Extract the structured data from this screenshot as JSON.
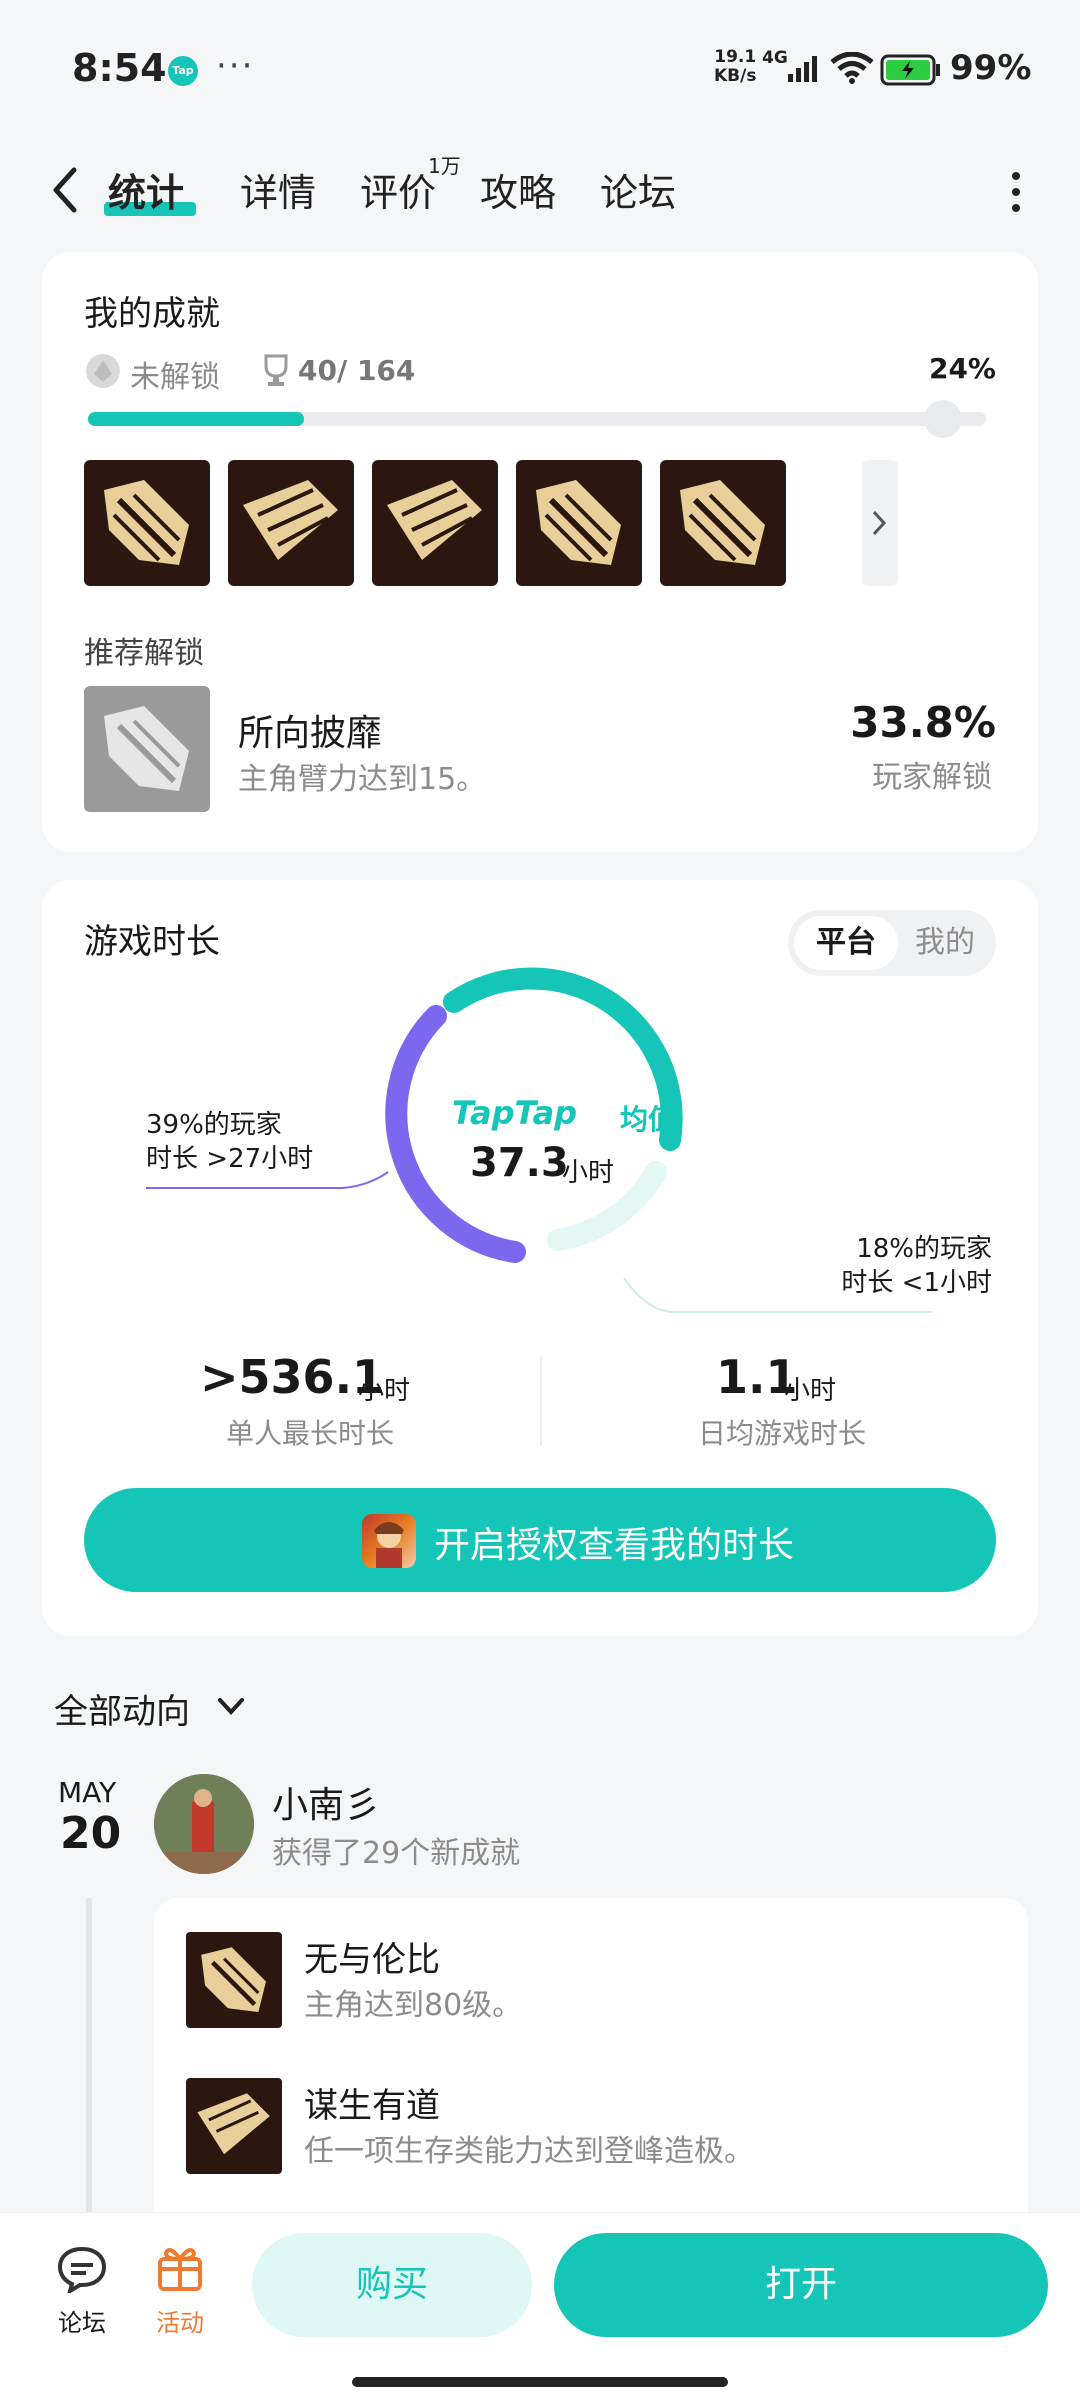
{
  "status_bar": {
    "time": "8:54",
    "app_badge": "Tap",
    "more": "···",
    "net_speed_value": "19.1",
    "net_speed_unit": "KB/s",
    "network": "4G",
    "battery": "99%"
  },
  "nav": {
    "tabs": [
      {
        "label": "统计",
        "active": true
      },
      {
        "label": "详情"
      },
      {
        "label": "评价",
        "badge": "1万"
      },
      {
        "label": "攻略"
      },
      {
        "label": "论坛"
      }
    ]
  },
  "achievements": {
    "title": "我的成就",
    "locked_label": "未解锁",
    "count": "40/ 164",
    "percent_text": "24%",
    "progress_fraction": 0.24,
    "thumb_names": [
      "所向披靡",
      "谋生有道",
      "谋生有道",
      "所向披靡",
      "所向披靡"
    ],
    "recommend": {
      "label": "推荐解锁",
      "name": "所向披靡",
      "desc": "主角臂力达到15。",
      "percent": "33.8%",
      "percent_label": "玩家解锁"
    }
  },
  "playtime": {
    "title": "游戏时长",
    "toggle": {
      "platform": "平台",
      "mine": "我的"
    },
    "brand": "TapTap",
    "avg_label": "均值",
    "avg_value": "37.3",
    "avg_unit": "小时",
    "ann_left_1": "39%的玩家",
    "ann_left_2": "时长 >27小时",
    "ann_right_1": "18%的玩家",
    "ann_right_2": "时长 <1小时",
    "max_value": ">536.1",
    "max_unit": "小时",
    "max_label": "单人最长时长",
    "daily_value": "1.1",
    "daily_unit": "小时",
    "daily_label": "日均游戏时长",
    "auth_button": "开启授权查看我的时长",
    "colors": {
      "teal": "#15c5b8",
      "purple": "#7b68ee",
      "light_teal": "#e6f8f6"
    }
  },
  "feed": {
    "filter": "全部动向",
    "month": "MAY",
    "day": "20",
    "user": "小南彡",
    "action": "获得了29个新成就",
    "items": [
      {
        "name": "无与伦比",
        "desc": "主角达到80级。"
      },
      {
        "name": "谋生有道",
        "desc": "任一项生存类能力达到登峰造极。"
      }
    ]
  },
  "bottom_bar": {
    "forum": "论坛",
    "event": "活动",
    "buy": "购买",
    "open": "打开"
  }
}
